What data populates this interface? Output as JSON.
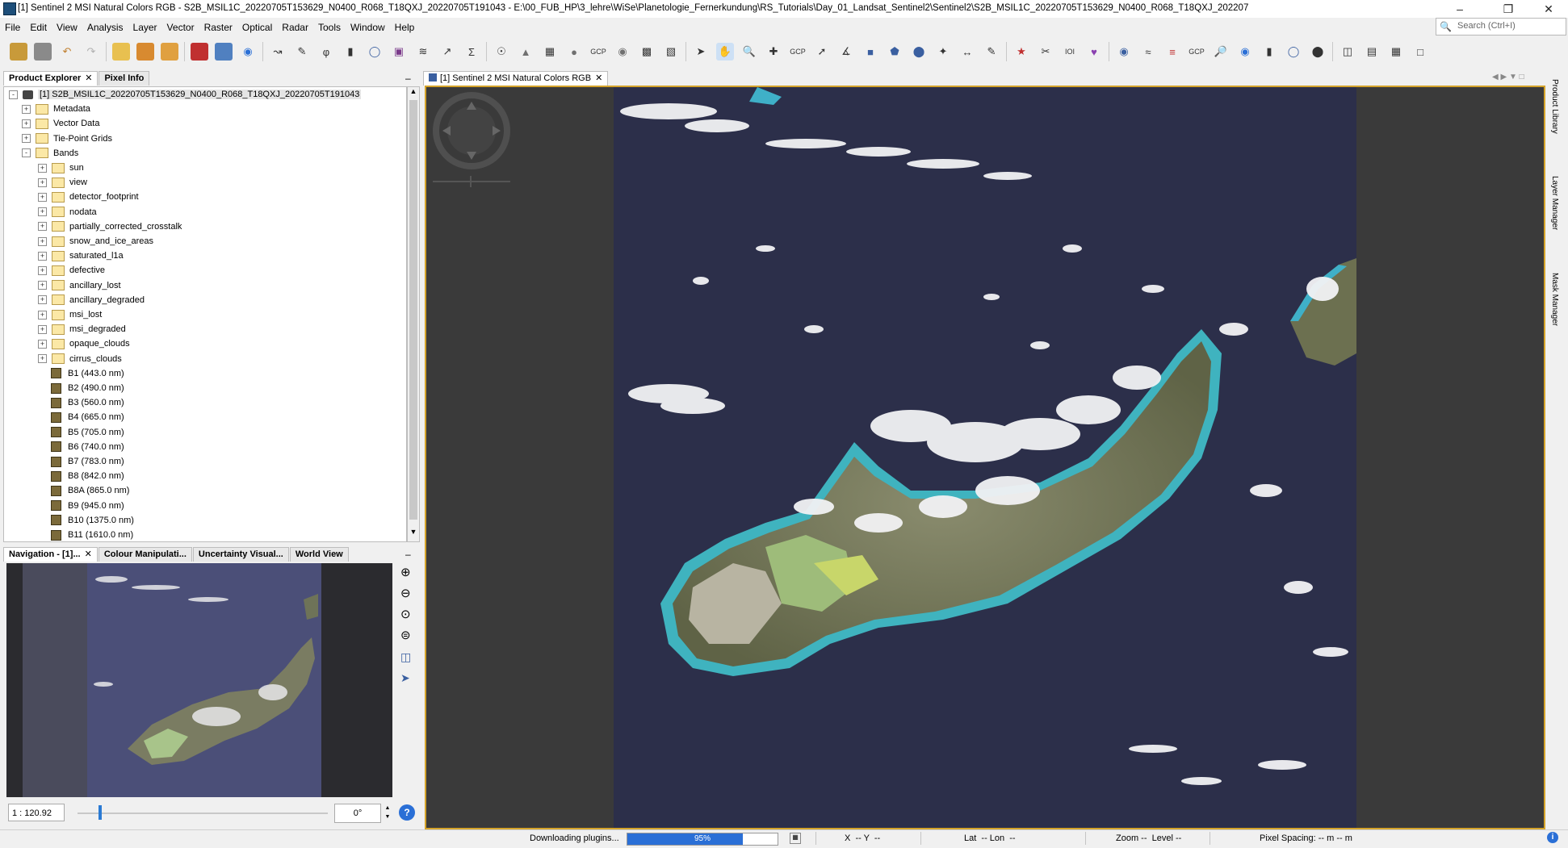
{
  "window": {
    "title": "[1] Sentinel 2 MSI Natural Colors RGB - S2B_MSIL1C_20220705T153629_N0400_R068_T18QXJ_20220705T191043 - E:\\00_FUB_HP\\3_lehre\\WiSe\\Planetologie_Fernerkundung\\RS_Tutorials\\Day_01_Landsat_Sentinel2\\Sentinel2\\S2B_MSIL1C_20220705T153629_N0400_R068_T18QXJ_202207"
  },
  "menu": [
    "File",
    "Edit",
    "View",
    "Analysis",
    "Layer",
    "Vector",
    "Raster",
    "Optical",
    "Radar",
    "Tools",
    "Window",
    "Help"
  ],
  "search": {
    "placeholder": "Search (Ctrl+I)"
  },
  "product_explorer": {
    "tabs": [
      "Product Explorer",
      "Pixel Info"
    ],
    "product": "[1] S2B_MSIL1C_20220705T153629_N0400_R068_T18QXJ_20220705T191043",
    "groups": [
      "Metadata",
      "Vector Data",
      "Tie-Point Grids",
      "Bands"
    ],
    "band_folders": [
      "sun",
      "view",
      "detector_footprint",
      "nodata",
      "partially_corrected_crosstalk",
      "snow_and_ice_areas",
      "saturated_l1a",
      "defective",
      "ancillary_lost",
      "ancillary_degraded",
      "msi_lost",
      "msi_degraded",
      "opaque_clouds",
      "cirrus_clouds"
    ],
    "bands": [
      "B1 (443.0 nm)",
      "B2 (490.0 nm)",
      "B3 (560.0 nm)",
      "B4 (665.0 nm)",
      "B5 (705.0 nm)",
      "B6 (740.0 nm)",
      "B7 (783.0 nm)",
      "B8 (842.0 nm)",
      "B8A (865.0 nm)",
      "B9 (945.0 nm)",
      "B10 (1375.0 nm)",
      "B11 (1610.0 nm)"
    ]
  },
  "navigation": {
    "tabs": [
      "Navigation - [1]...",
      "Colour Manipulati...",
      "Uncertainty Visual...",
      "World View"
    ],
    "scale": "1 : 120.92",
    "angle": "0°"
  },
  "image_view": {
    "tab_label": "[1] Sentinel 2 MSI Natural Colors RGB"
  },
  "right_strip": [
    "Product Library",
    "Layer Manager",
    "Mask Manager"
  ],
  "status": {
    "plugins_text": "Downloading plugins...",
    "progress_value": 95,
    "progress_label": "95%",
    "xy": "X  -- Y  --",
    "latlon": "Lat  -- Lon  --",
    "zoom_level": "Zoom --  Level --",
    "pixel_spacing": "Pixel Spacing: -- m -- m"
  },
  "colors": {
    "accent": "#2a6fd6",
    "view_border": "#d4a32a",
    "ocean": "#2c2f4a"
  }
}
